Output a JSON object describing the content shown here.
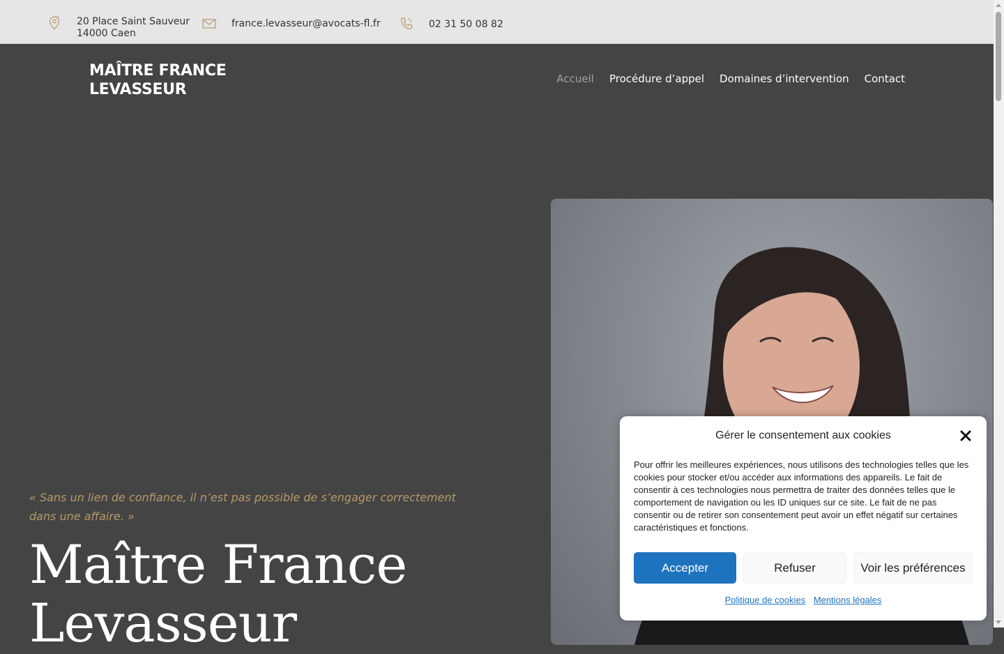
{
  "topbar": {
    "address_line1": "20 Place Saint Sauveur",
    "address_line2": "14000 Caen",
    "email": "france.levasseur@avocats-fl.fr",
    "phone": "02 31 50 08 82",
    "icon_color": "#b7996b"
  },
  "header": {
    "brand_line1": "MAÎTRE FRANCE",
    "brand_line2": "LEVASSEUR",
    "nav": [
      {
        "label": "Accueil",
        "active": true
      },
      {
        "label": "Procédure d’appel",
        "active": false
      },
      {
        "label": "Domaines d’intervention",
        "active": false
      },
      {
        "label": "Contact",
        "active": false
      }
    ]
  },
  "hero": {
    "quote_line1": "« Sans un lien de confiance, il n’est pas possible de s’engager correctement",
    "quote_line2": "dans une affaire. »",
    "title_line1": "Maître France",
    "title_line2": "Levasseur",
    "quote_color": "#b7996b",
    "background_color": "#444444"
  },
  "cookie": {
    "title": "Gérer le consentement aux cookies",
    "body": "Pour offrir les meilleures expériences, nous utilisons des technologies telles que les cookies pour stocker et/ou accéder aux informations des appareils. Le fait de consentir à ces technologies nous permettra de traiter des données telles que le comportement de navigation ou les ID uniques sur ce site. Le fait de ne pas consentir ou de retirer son consentement peut avoir un effet négatif sur certaines caractéristiques et fonctions.",
    "accept_label": "Accepter",
    "refuse_label": "Refuser",
    "prefs_label": "Voir les préférences",
    "link_policy": "Politique de cookies",
    "link_legal": "Mentions légales",
    "accent_color": "#1e73be"
  }
}
